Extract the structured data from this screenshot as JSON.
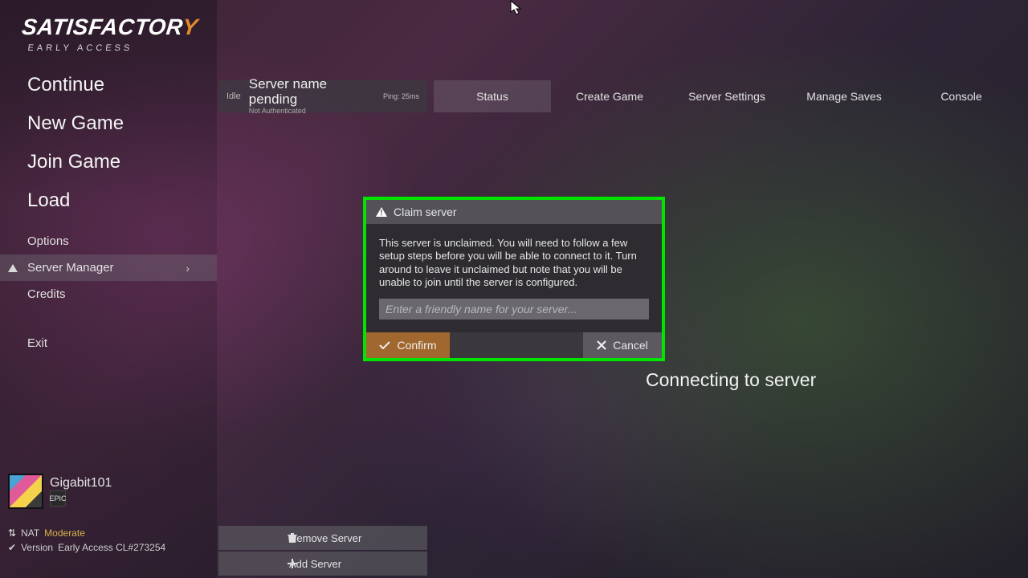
{
  "logo": {
    "title": "SATISFACTOR",
    "title_y": "Y",
    "subtitle": "EARLY ACCESS"
  },
  "menu": {
    "continue": "Continue",
    "new_game": "New Game",
    "join_game": "Join Game",
    "load": "Load",
    "options": "Options",
    "server_manager": "Server Manager",
    "credits": "Credits",
    "exit": "Exit"
  },
  "user": {
    "name": "Gigabit101",
    "platform": "EPIC"
  },
  "network": {
    "nat_label": "NAT",
    "nat_value": "Moderate",
    "version_label": "Version",
    "version_value": "Early Access CL#273254"
  },
  "server_chip": {
    "state": "Idle",
    "name": "Server name pending",
    "auth": "Not Authenticated",
    "ping": "Ping: 25ms"
  },
  "tabs": {
    "status": "Status",
    "create_game": "Create Game",
    "server_settings": "Server Settings",
    "manage_saves": "Manage Saves",
    "console": "Console"
  },
  "server_controls": {
    "remove": "Remove Server",
    "add": "Add Server"
  },
  "connecting": "Connecting to server",
  "modal": {
    "title": "Claim server",
    "body": "This server is unclaimed. You will need to follow a few setup steps before you will be able to connect to it. Turn around to leave it unclaimed but note that you will be unable to join until the server is configured.",
    "placeholder": "Enter a friendly name for your server...",
    "confirm": "Confirm",
    "cancel": "Cancel"
  }
}
